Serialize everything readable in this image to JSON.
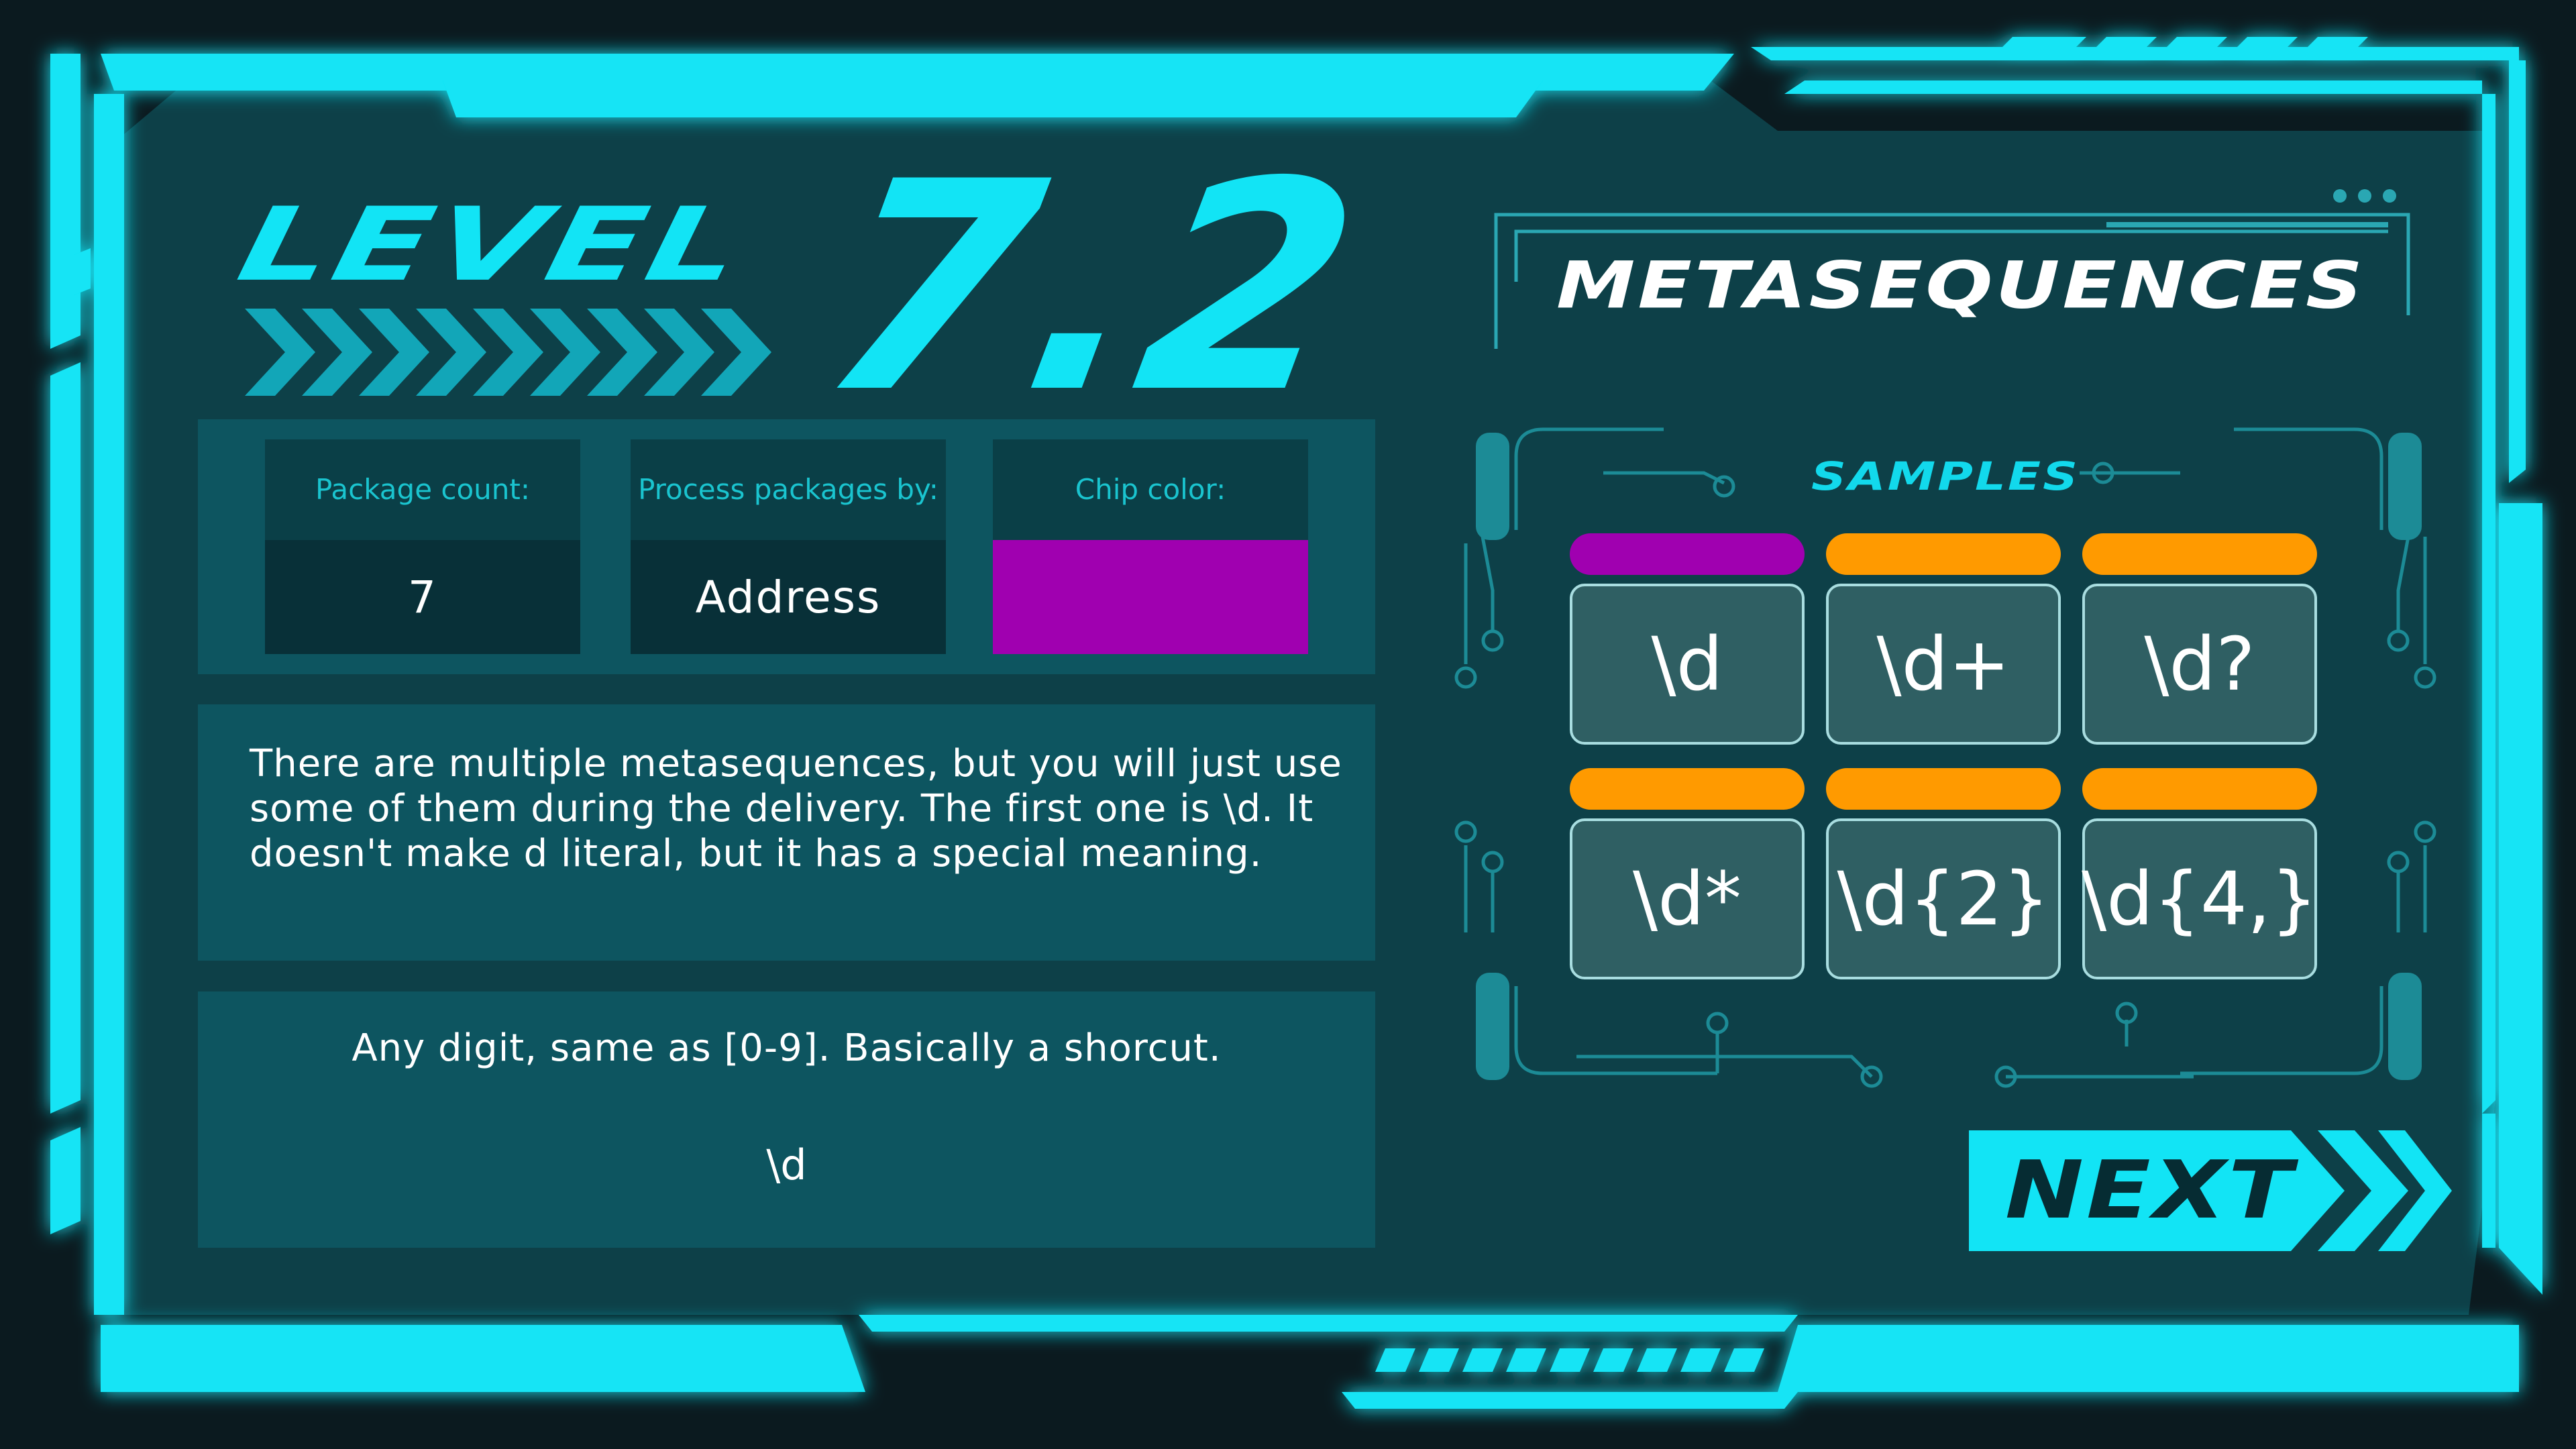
{
  "level": {
    "word": "LEVEL",
    "number": "7.2"
  },
  "info": {
    "package_count_label": "Package count:",
    "package_count_value": "7",
    "process_label": "Process packages by:",
    "process_value": "Address",
    "chip_color_label": "Chip color:",
    "chip_color_value": "#a000b0"
  },
  "description": "There are multiple metasequences, but you will just use some of them during the delivery. The first one is \\d. It doesn't make d literal, but it has a special meaning.",
  "hint": {
    "text": "Any digit, same as [0-9]. Basically a shorcut.",
    "code": "\\d"
  },
  "right_panel": {
    "title": "METASEQUENCES",
    "samples_title": "SAMPLES",
    "samples": [
      {
        "label": "\\d",
        "chip_color": "#a000b0"
      },
      {
        "label": "\\d+",
        "chip_color": "#ff9a00"
      },
      {
        "label": "\\d?",
        "chip_color": "#ff9a00"
      },
      {
        "label": "\\d*",
        "chip_color": "#ff9a00"
      },
      {
        "label": "\\d{2}",
        "chip_color": "#ff9a00"
      },
      {
        "label": "\\d{4,}",
        "chip_color": "#ff9a00"
      }
    ]
  },
  "next_button": {
    "label": "NEXT"
  },
  "colors": {
    "accent": "#12e4f5",
    "panel": "#0d5560",
    "background": "#0d4048",
    "frame_bg": "#0b1a1f"
  }
}
